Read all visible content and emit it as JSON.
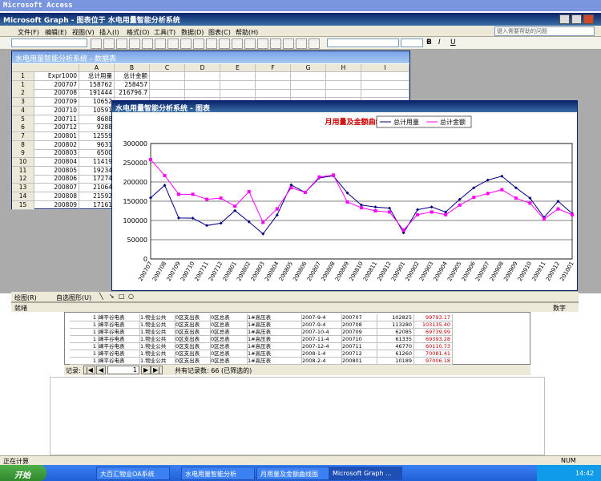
{
  "app_title": "Microsoft Access",
  "graph_title": "Microsoft Graph - 图表位于 水电用量智能分析系统",
  "menu": [
    "文件(F)",
    "编辑(E)",
    "视图(V)",
    "插入(I)",
    "格式(O)",
    "工具(T)",
    "数据(D)",
    "图表(C)",
    "帮助(H)"
  ],
  "help_placeholder": "键入需要帮助的问题",
  "datasheet_title": "水电用量智能分析系统 - 数据表",
  "chart_window_title": "水电用量智能分析系统 - 图表",
  "columns": [
    "A",
    "B",
    "C",
    "D",
    "E",
    "F",
    "G",
    "H",
    "I"
  ],
  "col_a_label": "总计用量",
  "col_b_label": "总计金额",
  "sheet_rows": [
    {
      "n": "1",
      "key": "Expr1000",
      "a": "总计用量",
      "b": "总计金额"
    },
    {
      "n": "1",
      "key": "200707",
      "a": "158762",
      "b": "258457"
    },
    {
      "n": "2",
      "key": "200708",
      "a": "191444",
      "b": "216796.7"
    },
    {
      "n": "3",
      "key": "200709",
      "a": "10652",
      "b": ""
    },
    {
      "n": "4",
      "key": "200710",
      "a": "10591",
      "b": ""
    },
    {
      "n": "5",
      "key": "200711",
      "a": "8688",
      "b": ""
    },
    {
      "n": "6",
      "key": "200712",
      "a": "9288",
      "b": ""
    },
    {
      "n": "7",
      "key": "200801",
      "a": "12559",
      "b": ""
    },
    {
      "n": "8",
      "key": "200802",
      "a": "9631",
      "b": ""
    },
    {
      "n": "9",
      "key": "200803",
      "a": "6500",
      "b": ""
    },
    {
      "n": "10",
      "key": "200804",
      "a": "11419",
      "b": ""
    },
    {
      "n": "11",
      "key": "200805",
      "a": "19234",
      "b": ""
    },
    {
      "n": "12",
      "key": "200806",
      "a": "17274",
      "b": ""
    },
    {
      "n": "13",
      "key": "200807",
      "a": "21064",
      "b": ""
    },
    {
      "n": "14",
      "key": "200808",
      "a": "21592",
      "b": ""
    },
    {
      "n": "15",
      "key": "200809",
      "a": "17161",
      "b": ""
    }
  ],
  "chart_data": {
    "type": "line",
    "title": "月用量及金额曲线图",
    "categories": [
      "200707",
      "200708",
      "200709",
      "200710",
      "200711",
      "200712",
      "200801",
      "200802",
      "200803",
      "200804",
      "200805",
      "200806",
      "200807",
      "200808",
      "200809",
      "200810",
      "200811",
      "200812",
      "200901",
      "200902",
      "200903",
      "200904",
      "200905",
      "200906",
      "200907",
      "200908",
      "200909",
      "200910",
      "200911",
      "200912",
      "201001"
    ],
    "series": [
      {
        "name": "总计用量",
        "color": "#000080",
        "values": [
          158762,
          191444,
          106520,
          105910,
          86880,
          92880,
          125590,
          96310,
          65000,
          114190,
          192340,
          172740,
          210640,
          215920,
          171610,
          140000,
          135000,
          132000,
          68000,
          128000,
          135000,
          122000,
          155000,
          185000,
          205000,
          215000,
          185000,
          158000,
          108000,
          150000,
          118000
        ]
      },
      {
        "name": "总计金额",
        "color": "#ff00ff",
        "values": [
          258457,
          216797,
          168000,
          168000,
          155000,
          158000,
          137000,
          175000,
          95000,
          130000,
          185000,
          173000,
          213000,
          218000,
          148000,
          133000,
          125000,
          122000,
          75000,
          115000,
          122000,
          115000,
          140000,
          160000,
          170000,
          180000,
          158000,
          145000,
          104000,
          130000,
          115000
        ]
      }
    ],
    "yticks": [
      "300000",
      "250000",
      "200000",
      "150000",
      "100000",
      "50000",
      "0"
    ],
    "ylim": [
      0,
      300000
    ],
    "legend": "top-right"
  },
  "drawing_label": "绘图(R)",
  "autoshape_label": "自选图形(U)",
  "status_ready": "就绪",
  "status_num": "数字",
  "access_rows": [
    {
      "a": "1",
      "b": "嶂平谷电表",
      "c": "1.物业公共",
      "d": "0区支出表",
      "e": "0区总表",
      "f": "1#高压表",
      "g": "2007-9-4",
      "h": "200707",
      "i": "102825",
      "j": "99793.17"
    },
    {
      "a": "1",
      "b": "嶂平谷电表",
      "c": "1.物业公共",
      "d": "0区支出表",
      "e": "0区总表",
      "f": "1#高压表",
      "g": "2007-9-4",
      "h": "200708",
      "i": "113280",
      "j": "103135.40"
    },
    {
      "a": "1",
      "b": "嶂平谷电表",
      "c": "1.物业公共",
      "d": "0区支出表",
      "e": "0区总表",
      "f": "1#高压表",
      "g": "2007-10-4",
      "h": "200709",
      "i": "62085",
      "j": "69739.99"
    },
    {
      "a": "1",
      "b": "嶂平谷电表",
      "c": "1.物业公共",
      "d": "0区支出表",
      "e": "0区总表",
      "f": "1#高压表",
      "g": "2007-11-4",
      "h": "200710",
      "i": "61335",
      "j": "69393.28"
    },
    {
      "a": "1",
      "b": "嶂平谷电表",
      "c": "1.物业公共",
      "d": "0区支出表",
      "e": "0区总表",
      "f": "1#高压表",
      "g": "2007-12-4",
      "h": "200711",
      "i": "46770",
      "j": "60110.73"
    },
    {
      "a": "1",
      "b": "嶂平谷电表",
      "c": "1.物业公共",
      "d": "0区支出表",
      "e": "0区总表",
      "f": "1#高压表",
      "g": "2008-1-4",
      "h": "200712",
      "i": "61260",
      "j": "70081.41"
    },
    {
      "a": "1",
      "b": "嶂平谷电表",
      "c": "1.物业公共",
      "d": "0区支出表",
      "e": "0区总表",
      "f": "1#高压表",
      "g": "2008-2-4",
      "h": "200801",
      "i": "10189",
      "j": "97006.18"
    }
  ],
  "record_label": "记录:",
  "record_current": "1",
  "record_total": "共有记录数: 66 (已筛选的)",
  "bottom_status": "正在计算",
  "bottom_right": "NUM",
  "start_label": "开始",
  "tasks": [
    "大百汇物业OA系统",
    "水电用量智能分析",
    "月用量及金额曲线图",
    "Microsoft Graph ..."
  ],
  "clock": "14:42"
}
